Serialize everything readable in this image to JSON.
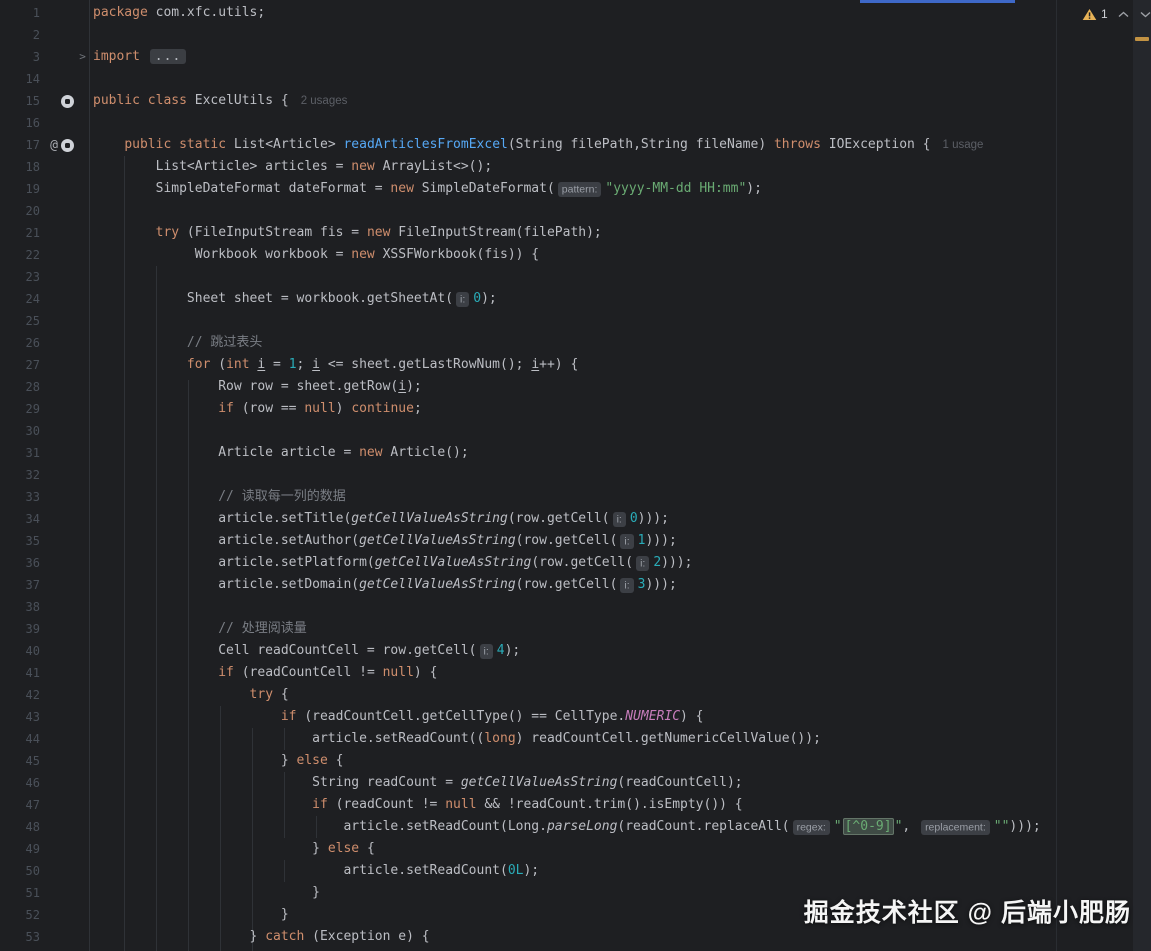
{
  "palette": {
    "background": "#1E1F22",
    "keyword": "#CF8E6D",
    "string": "#6AAB73",
    "number": "#2AACB8",
    "comment": "#7A7E85",
    "method_declaration": "#56A8F5",
    "constant": "#C77DBB",
    "text": "#BCBEC4",
    "warning": "#E8B357",
    "accent_blue": "#3E68C8"
  },
  "inspections": {
    "warning_count": "1",
    "icons": [
      "warning-triangle-icon",
      "chevron-up-icon",
      "chevron-down-icon"
    ]
  },
  "watermark": {
    "text": "掘金技术社区 @ 后端小肥肠"
  },
  "gutter_icons_legend": [
    "annotation-at-icon",
    "gutter-class-icon",
    "fold-arrow-icon",
    "warning-stripe-mark"
  ],
  "code": {
    "lines": [
      {
        "n": "1",
        "s": [
          [
            "k",
            "package"
          ],
          [
            "d",
            " com.xfc.utils;"
          ]
        ]
      },
      {
        "n": "2",
        "s": []
      },
      {
        "n": "3",
        "fold": true,
        "s": [
          [
            "k",
            "import"
          ],
          [
            "d",
            " "
          ],
          [
            "fold",
            "..."
          ]
        ]
      },
      {
        "n": "14",
        "s": []
      },
      {
        "n": "15",
        "icons": [
          "target"
        ],
        "s": [
          [
            "k",
            "public"
          ],
          [
            "d",
            " "
          ],
          [
            "k",
            "class"
          ],
          [
            "d",
            " ExcelUtils {"
          ],
          [
            "usage",
            "2 usages"
          ]
        ]
      },
      {
        "n": "16",
        "s": []
      },
      {
        "n": "17",
        "icons": [
          "at",
          "target"
        ],
        "s": [
          [
            "d",
            "    "
          ],
          [
            "k",
            "public"
          ],
          [
            "d",
            " "
          ],
          [
            "k",
            "static"
          ],
          [
            "d",
            " List<Article> "
          ],
          [
            "m",
            "readArticlesFromExcel"
          ],
          [
            "d",
            "(String filePath,String fileName) "
          ],
          [
            "k",
            "throws"
          ],
          [
            "d",
            " IOException {"
          ],
          [
            "usage",
            "1 usage"
          ]
        ]
      },
      {
        "n": "18",
        "s": [
          [
            "d",
            "        List<Article> articles = "
          ],
          [
            "k",
            "new"
          ],
          [
            "d",
            " ArrayList<>();"
          ]
        ]
      },
      {
        "n": "19",
        "s": [
          [
            "d",
            "        SimpleDateFormat dateFormat = "
          ],
          [
            "k",
            "new"
          ],
          [
            "d",
            " SimpleDateFormat("
          ],
          [
            "chip",
            "pattern:"
          ],
          [
            "s",
            "\"yyyy-MM-dd HH:mm\""
          ],
          [
            "d",
            ");"
          ]
        ]
      },
      {
        "n": "20",
        "s": []
      },
      {
        "n": "21",
        "s": [
          [
            "d",
            "        "
          ],
          [
            "k",
            "try"
          ],
          [
            "d",
            " (FileInputStream fis = "
          ],
          [
            "k",
            "new"
          ],
          [
            "d",
            " FileInputStream(filePath);"
          ]
        ]
      },
      {
        "n": "22",
        "s": [
          [
            "d",
            "             Workbook workbook = "
          ],
          [
            "k",
            "new"
          ],
          [
            "d",
            " XSSFWorkbook(fis)) {"
          ]
        ]
      },
      {
        "n": "23",
        "s": []
      },
      {
        "n": "24",
        "s": [
          [
            "d",
            "            Sheet sheet = workbook.getSheetAt("
          ],
          [
            "chip",
            "i:"
          ],
          [
            "n",
            "0"
          ],
          [
            "d",
            ");"
          ]
        ]
      },
      {
        "n": "25",
        "s": []
      },
      {
        "n": "26",
        "s": [
          [
            "d",
            "            "
          ],
          [
            "c",
            "// 跳过表头"
          ]
        ]
      },
      {
        "n": "27",
        "s": [
          [
            "d",
            "            "
          ],
          [
            "k",
            "for"
          ],
          [
            "d",
            " ("
          ],
          [
            "k",
            "int"
          ],
          [
            "d",
            " "
          ],
          [
            "u",
            "i"
          ],
          [
            "d",
            " = "
          ],
          [
            "n",
            "1"
          ],
          [
            "d",
            "; "
          ],
          [
            "u",
            "i"
          ],
          [
            "d",
            " <= sheet.getLastRowNum(); "
          ],
          [
            "u",
            "i"
          ],
          [
            "d",
            "++) {"
          ]
        ]
      },
      {
        "n": "28",
        "s": [
          [
            "d",
            "                Row row = sheet.getRow("
          ],
          [
            "u",
            "i"
          ],
          [
            "d",
            ");"
          ]
        ]
      },
      {
        "n": "29",
        "s": [
          [
            "d",
            "                "
          ],
          [
            "k",
            "if"
          ],
          [
            "d",
            " (row == "
          ],
          [
            "k",
            "null"
          ],
          [
            "d",
            ") "
          ],
          [
            "k",
            "continue"
          ],
          [
            "d",
            ";"
          ]
        ]
      },
      {
        "n": "30",
        "s": []
      },
      {
        "n": "31",
        "s": [
          [
            "d",
            "                Article article = "
          ],
          [
            "k",
            "new"
          ],
          [
            "d",
            " Article();"
          ]
        ]
      },
      {
        "n": "32",
        "s": []
      },
      {
        "n": "33",
        "s": [
          [
            "d",
            "                "
          ],
          [
            "c",
            "// 读取每一列的数据"
          ]
        ]
      },
      {
        "n": "34",
        "s": [
          [
            "d",
            "                article.setTitle("
          ],
          [
            "i",
            "getCellValueAsString"
          ],
          [
            "d",
            "(row.getCell("
          ],
          [
            "chip",
            "i:"
          ],
          [
            "n",
            "0"
          ],
          [
            "d",
            ")));"
          ]
        ]
      },
      {
        "n": "35",
        "s": [
          [
            "d",
            "                article.setAuthor("
          ],
          [
            "i",
            "getCellValueAsString"
          ],
          [
            "d",
            "(row.getCell("
          ],
          [
            "chip",
            "i:"
          ],
          [
            "n",
            "1"
          ],
          [
            "d",
            ")));"
          ]
        ]
      },
      {
        "n": "36",
        "s": [
          [
            "d",
            "                article.setPlatform("
          ],
          [
            "i",
            "getCellValueAsString"
          ],
          [
            "d",
            "(row.getCell("
          ],
          [
            "chip",
            "i:"
          ],
          [
            "n",
            "2"
          ],
          [
            "d",
            ")));"
          ]
        ]
      },
      {
        "n": "37",
        "s": [
          [
            "d",
            "                article.setDomain("
          ],
          [
            "i",
            "getCellValueAsString"
          ],
          [
            "d",
            "(row.getCell("
          ],
          [
            "chip",
            "i:"
          ],
          [
            "n",
            "3"
          ],
          [
            "d",
            ")));"
          ]
        ]
      },
      {
        "n": "38",
        "s": []
      },
      {
        "n": "39",
        "s": [
          [
            "d",
            "                "
          ],
          [
            "c",
            "// 处理阅读量"
          ]
        ]
      },
      {
        "n": "40",
        "s": [
          [
            "d",
            "                Cell readCountCell = row.getCell("
          ],
          [
            "chip",
            "i:"
          ],
          [
            "n",
            "4"
          ],
          [
            "d",
            ");"
          ]
        ]
      },
      {
        "n": "41",
        "s": [
          [
            "d",
            "                "
          ],
          [
            "k",
            "if"
          ],
          [
            "d",
            " (readCountCell != "
          ],
          [
            "k",
            "null"
          ],
          [
            "d",
            ") {"
          ]
        ]
      },
      {
        "n": "42",
        "s": [
          [
            "d",
            "                    "
          ],
          [
            "k",
            "try"
          ],
          [
            "d",
            " {"
          ]
        ]
      },
      {
        "n": "43",
        "s": [
          [
            "d",
            "                        "
          ],
          [
            "k",
            "if"
          ],
          [
            "d",
            " (readCountCell.getCellType() == CellType."
          ],
          [
            "p",
            "NUMERIC"
          ],
          [
            "d",
            ") {"
          ]
        ]
      },
      {
        "n": "44",
        "s": [
          [
            "d",
            "                            article.setReadCount(("
          ],
          [
            "k",
            "long"
          ],
          [
            "d",
            ") readCountCell.getNumericCellValue());"
          ]
        ]
      },
      {
        "n": "45",
        "s": [
          [
            "d",
            "                        } "
          ],
          [
            "k",
            "else"
          ],
          [
            "d",
            " {"
          ]
        ]
      },
      {
        "n": "46",
        "s": [
          [
            "d",
            "                            String readCount = "
          ],
          [
            "i",
            "getCellValueAsString"
          ],
          [
            "d",
            "(readCountCell);"
          ]
        ]
      },
      {
        "n": "47",
        "s": [
          [
            "d",
            "                            "
          ],
          [
            "k",
            "if"
          ],
          [
            "d",
            " (readCount != "
          ],
          [
            "k",
            "null"
          ],
          [
            "d",
            " && !readCount.trim().isEmpty()) {"
          ]
        ]
      },
      {
        "n": "48",
        "s": [
          [
            "d",
            "                                article.setReadCount(Long."
          ],
          [
            "i",
            "parseLong"
          ],
          [
            "d",
            "(readCount.replaceAll("
          ],
          [
            "chip",
            "regex:"
          ],
          [
            "s",
            "\""
          ],
          [
            "hl",
            "[^0-9]"
          ],
          [
            "s",
            "\""
          ],
          [
            "d",
            ", "
          ],
          [
            "chip",
            "replacement:"
          ],
          [
            "s",
            "\"\""
          ],
          [
            "d",
            ")));"
          ]
        ]
      },
      {
        "n": "49",
        "s": [
          [
            "d",
            "                            } "
          ],
          [
            "k",
            "else"
          ],
          [
            "d",
            " {"
          ]
        ]
      },
      {
        "n": "50",
        "s": [
          [
            "d",
            "                                article.setReadCount("
          ],
          [
            "n",
            "0L"
          ],
          [
            "d",
            ");"
          ]
        ]
      },
      {
        "n": "51",
        "s": [
          [
            "d",
            "                            }"
          ]
        ]
      },
      {
        "n": "52",
        "s": [
          [
            "d",
            "                        }"
          ]
        ]
      },
      {
        "n": "53",
        "s": [
          [
            "d",
            "                    } "
          ],
          [
            "k",
            "catch"
          ],
          [
            "d",
            " (Exception e) {"
          ]
        ]
      }
    ]
  }
}
